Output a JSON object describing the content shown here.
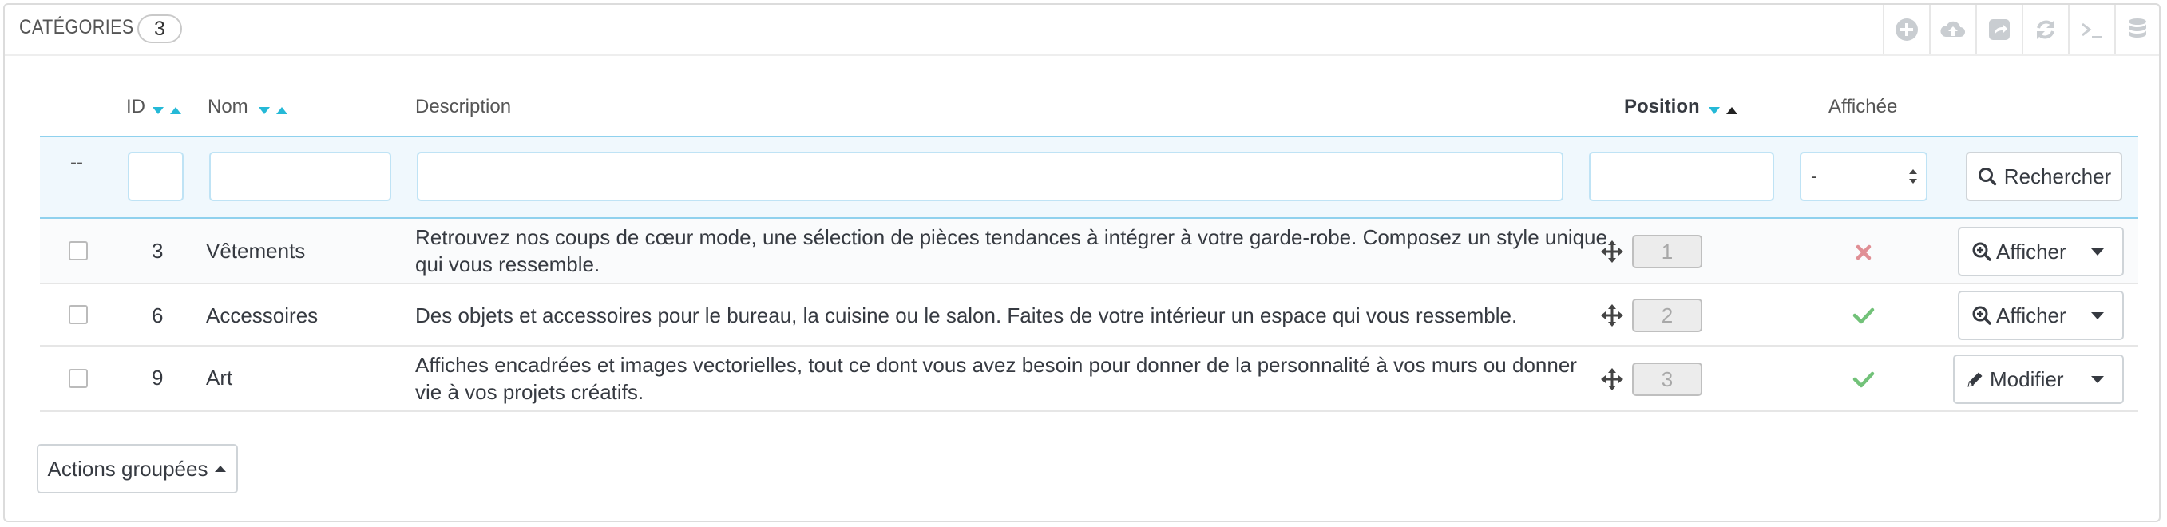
{
  "panel": {
    "title": "CATÉGORIES",
    "count": "3",
    "toolbar": [
      {
        "icon": "add-icon"
      },
      {
        "icon": "cloud-upload-icon"
      },
      {
        "icon": "export-icon"
      },
      {
        "icon": "refresh-icon"
      },
      {
        "icon": "sql-terminal-icon"
      },
      {
        "icon": "database-icon"
      }
    ]
  },
  "table": {
    "headers": {
      "id": "ID",
      "name": "Nom",
      "description": "Description",
      "position": "Position",
      "displayed": "Affichée"
    },
    "filters": {
      "bulk_placeholder": "--",
      "displayed_select": "-",
      "search_label": "Rechercher"
    },
    "rows": [
      {
        "id": "3",
        "name": "Vêtements",
        "description_line1": "Retrouvez nos coups de cœur mode, une sélection de pièces tendances à intégrer à votre garde-robe. Composez un style unique",
        "description_line2": "qui vous ressemble.",
        "position": "1",
        "displayed": false,
        "action": "Afficher"
      },
      {
        "id": "6",
        "name": "Accessoires",
        "description_line1": "Des objets et accessoires pour le bureau, la cuisine ou le salon. Faites de votre intérieur un espace qui vous ressemble.",
        "description_line2": "",
        "position": "2",
        "displayed": true,
        "action": "Afficher"
      },
      {
        "id": "9",
        "name": "Art",
        "description_line1": "Affiches encadrées et images vectorielles, tout ce dont vous avez besoin pour donner de la personnalité à vos murs ou donner",
        "description_line2": "vie à vos projets créatifs.",
        "position": "3",
        "displayed": true,
        "action": "Modifier"
      }
    ]
  },
  "bulk_actions": {
    "label": "Actions groupées"
  },
  "colors": {
    "accent": "#25b9d7",
    "success": "#72c279",
    "danger": "#e08f95",
    "filter_bg": "#f0f8fd"
  }
}
